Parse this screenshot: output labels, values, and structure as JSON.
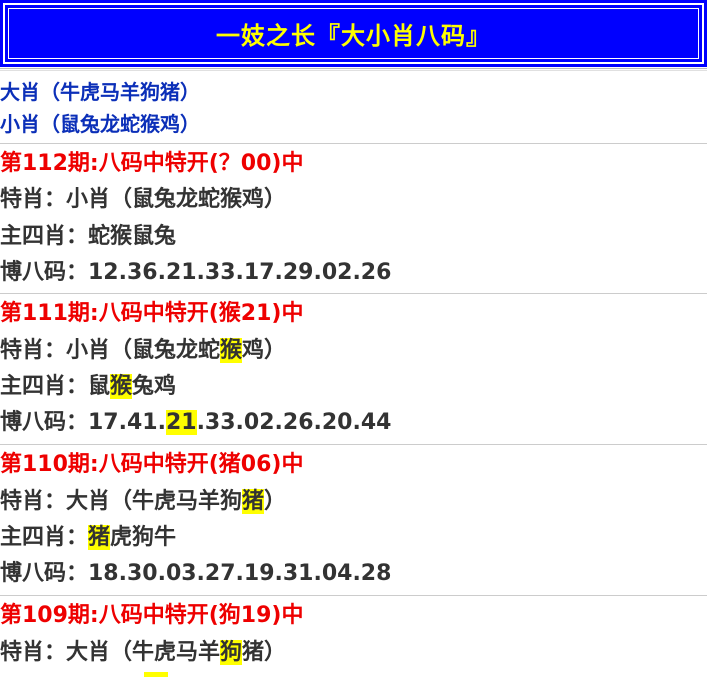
{
  "header": {
    "title": "一妓之长『大小肖八码』"
  },
  "intro": {
    "big_label": "大肖（牛虎马羊狗猪）",
    "small_label": "小肖（鼠兔龙蛇猴鸡）"
  },
  "records": [
    {
      "period": "第112期:八码中特开(？00)中",
      "special_prefix": "特肖：小肖（鼠兔龙蛇猴鸡）",
      "main_prefix": "主四肖：蛇猴鼠兔",
      "eight_prefix": "博八码：12.36.21.33.17.29.02.26"
    },
    {
      "period": "第111期:八码中特开(猴21)中",
      "special_prefix": "特肖：小肖（鼠兔龙蛇",
      "special_hl": "猴",
      "special_suffix": "鸡）",
      "main_prefix": "主四肖：鼠",
      "main_hl": "猴",
      "main_suffix": "兔鸡",
      "eight_prefix": "博八码：17.41.",
      "eight_hl": "21",
      "eight_suffix": ".33.02.26.20.44"
    },
    {
      "period": "第110期:八码中特开(猪06)中",
      "special_prefix": "特肖：大肖（牛虎马羊狗",
      "special_hl": "猪",
      "special_suffix": "）",
      "main_prefix": "主四肖：",
      "main_hl": "猪",
      "main_suffix": "虎狗牛",
      "eight_prefix": "博八码：18.30.03.27.19.31.04.28"
    },
    {
      "period": "第109期:八码中特开(狗19)中",
      "special_prefix": "特肖：大肖（牛虎马羊",
      "special_hl": "狗",
      "special_suffix": "猪）"
    }
  ],
  "colors": {
    "header_bg": "#0000ff",
    "header_text": "#ffff00",
    "intro_text": "#0b2fb8",
    "period_text": "#ee0000",
    "body_text": "#333333",
    "highlight": "#ffff00"
  }
}
